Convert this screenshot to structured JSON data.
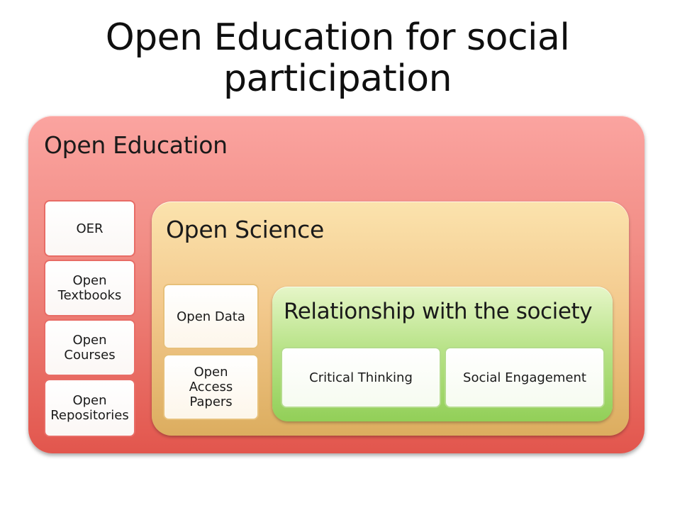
{
  "title": "Open Education for social participation",
  "open_education": {
    "label": "Open Education",
    "items": [
      "OER",
      "Open Textbooks",
      "Open Courses",
      "Open Repositories"
    ]
  },
  "open_science": {
    "label": "Open Science",
    "items": [
      "Open Data",
      "Open Access Papers"
    ]
  },
  "society": {
    "label": "Relationship with the society",
    "items": [
      "Critical Thinking",
      "Social Engagement"
    ]
  },
  "colors": {
    "open_education": "#f18c84",
    "open_science": "#f3c98d",
    "society": "#b9e389"
  }
}
